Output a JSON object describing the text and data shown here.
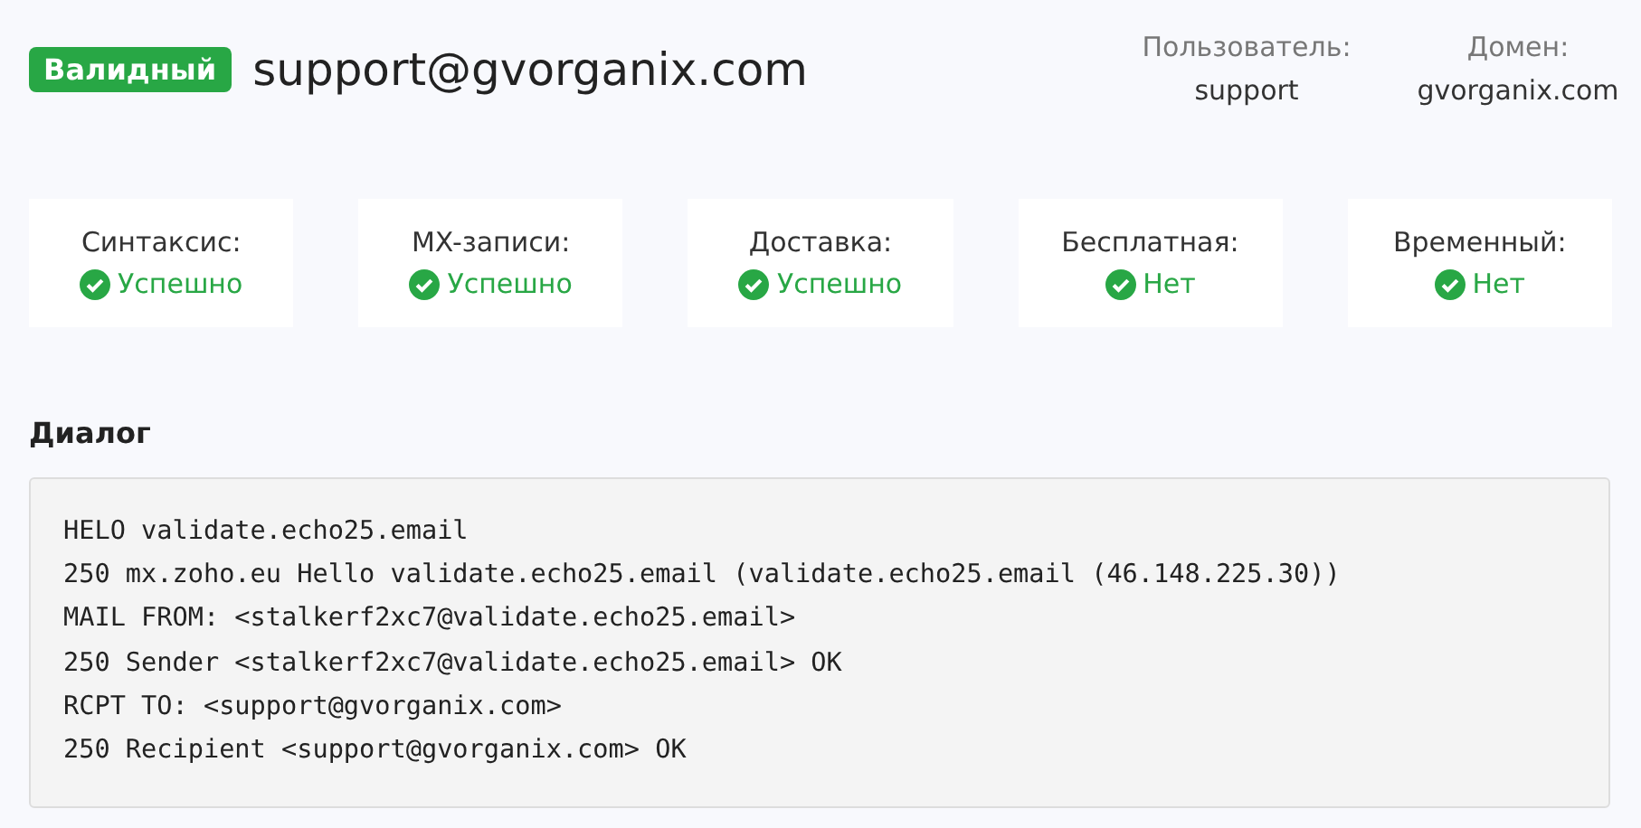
{
  "header": {
    "badge": "Валидный",
    "email": "support@gvorganix.com",
    "details": [
      {
        "label": "Пользователь:",
        "value": "support"
      },
      {
        "label": "Домен:",
        "value": "gvorganix.com"
      }
    ]
  },
  "checks": [
    {
      "label": "Синтаксис:",
      "result": "Успешно",
      "ok": true
    },
    {
      "label": "MX-записи:",
      "result": "Успешно",
      "ok": true
    },
    {
      "label": "Доставка:",
      "result": "Успешно",
      "ok": true
    },
    {
      "label": "Бесплатная:",
      "result": "Нет",
      "ok": true
    },
    {
      "label": "Временный:",
      "result": "Нет",
      "ok": true
    }
  ],
  "dialog": {
    "title": "Диалог",
    "lines": [
      "HELO validate.echo25.email",
      "250 mx.zoho.eu Hello validate.echo25.email (validate.echo25.email (46.148.225.30))",
      "MAIL FROM: <stalkerf2xc7@validate.echo25.email>",
      "250 Sender <stalkerf2xc7@validate.echo25.email> OK",
      "RCPT TO: <support@gvorganix.com>",
      "250 Recipient <support@gvorganix.com> OK"
    ]
  }
}
